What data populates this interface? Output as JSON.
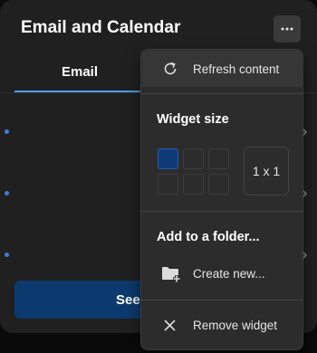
{
  "widget": {
    "title": "Email and Calendar",
    "tabs": [
      {
        "label": "Email",
        "active": true
      }
    ],
    "see_button_label": "See"
  },
  "menu": {
    "refresh_label": "Refresh content",
    "widget_size_heading": "Widget size",
    "size_grid": {
      "rows": 2,
      "cols": 3,
      "selected": [
        0,
        0
      ]
    },
    "size_value": "1 x 1",
    "folder_heading": "Add to a folder...",
    "create_new_label": "Create new...",
    "remove_label": "Remove widget"
  },
  "colors": {
    "accent": "#4a9ee8",
    "selected_cell": "#0f3a78",
    "button_bg": "#0d3a6e"
  }
}
